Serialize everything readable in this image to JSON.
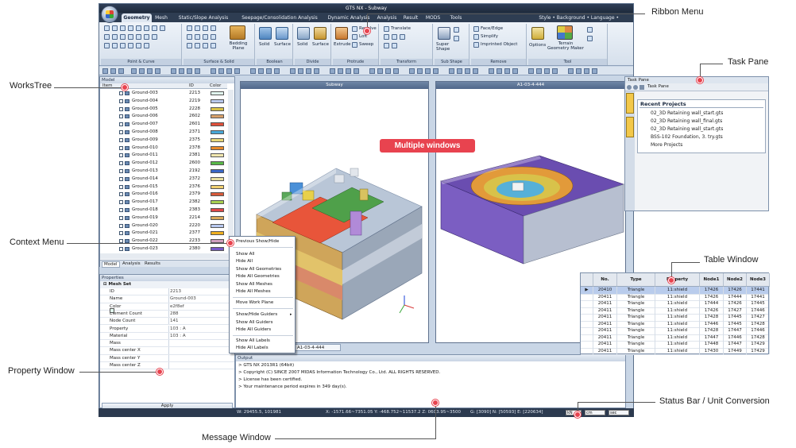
{
  "callouts": {
    "ribbon_menu": "Ribbon Menu",
    "task_pane": "Task Pane",
    "works_tree": "WorksTree",
    "context_menu": "Context Menu",
    "table_window": "Table Window",
    "property_window": "Property Window",
    "status_bar": "Status Bar / Unit Conversion",
    "message_window": "Message Window",
    "multiple_windows": "Multiple windows"
  },
  "window": {
    "title": "GTS NX - Subway"
  },
  "ribbon_tabs": [
    "Geometry",
    "Mesh",
    "Static/Slope Analysis",
    "Seepage/Consolidation Analysis",
    "Dynamic Analysis",
    "Analysis",
    "Result",
    "MODS",
    "Tools"
  ],
  "tabs_right": "Style  •  Background  •  Language  •",
  "ribbon_groups": [
    {
      "name": "Point & Curve"
    },
    {
      "name": "Surface & Solid",
      "big_label": "Bedding Plane"
    },
    {
      "name": "Boolean",
      "labels": [
        "Solid",
        "Surface"
      ]
    },
    {
      "name": "Divide",
      "labels": [
        "Solid",
        "Surface"
      ]
    },
    {
      "name": "Protrude",
      "labels": [
        "Extrude",
        "Revolve",
        "Loft",
        "Sweep"
      ]
    },
    {
      "name": "Transform",
      "labels": [
        "Translate"
      ]
    },
    {
      "name": "Sub Shape",
      "labels": [
        "Super Shape"
      ]
    },
    {
      "name": "Remove",
      "labels": [
        "Face/Edge",
        "Simplify",
        "Imprinted Object"
      ]
    },
    {
      "name": "Tool",
      "labels": [
        "Options",
        "Terrain Geometry Maker"
      ]
    }
  ],
  "works_tree": {
    "header": "Model",
    "columns": [
      "Item",
      "ID",
      "Color"
    ],
    "rows": [
      {
        "name": "Ground-003",
        "id": "2213",
        "color": "#e2f8ef"
      },
      {
        "name": "Ground-004",
        "id": "2219",
        "color": "#b9c9ee"
      },
      {
        "name": "Ground-005",
        "id": "2228",
        "color": "#d9c24a"
      },
      {
        "name": "Ground-006",
        "id": "2602",
        "color": "#d8a06a"
      },
      {
        "name": "Ground-007",
        "id": "2601",
        "color": "#e0503a"
      },
      {
        "name": "Ground-008",
        "id": "2371",
        "color": "#48a8d8"
      },
      {
        "name": "Ground-009",
        "id": "2375",
        "color": "#e8d878"
      },
      {
        "name": "Ground-010",
        "id": "2378",
        "color": "#e88a2a"
      },
      {
        "name": "Ground-011",
        "id": "2381",
        "color": "#f2e8b0"
      },
      {
        "name": "Ground-012",
        "id": "2600",
        "color": "#58b848"
      },
      {
        "name": "Ground-013",
        "id": "2192",
        "color": "#3a68c8"
      },
      {
        "name": "Ground-014",
        "id": "2372",
        "color": "#e8e0a0"
      },
      {
        "name": "Ground-015",
        "id": "2376",
        "color": "#f0d070"
      },
      {
        "name": "Ground-016",
        "id": "2379",
        "color": "#d85a3a"
      },
      {
        "name": "Ground-017",
        "id": "2382",
        "color": "#a8d050"
      },
      {
        "name": "Ground-018",
        "id": "2383",
        "color": "#e04848"
      },
      {
        "name": "Ground-019",
        "id": "2214",
        "color": "#d8a85a"
      },
      {
        "name": "Ground-020",
        "id": "2220",
        "color": "#b8c8f0"
      },
      {
        "name": "Ground-021",
        "id": "2377",
        "color": "#f0b020"
      },
      {
        "name": "Ground-022",
        "id": "2233",
        "color": "#d0a0c0"
      },
      {
        "name": "Ground-023",
        "id": "2380",
        "color": "#7858c8"
      }
    ],
    "bottom_tabs": [
      "Model",
      "Analysis",
      "Results"
    ]
  },
  "properties": {
    "header": "Properties",
    "section": "Mesh Set",
    "rows": [
      {
        "k": "ID",
        "v": "2213"
      },
      {
        "k": "Name",
        "v": "Ground-003"
      },
      {
        "k": "Color",
        "v": "e2f8ef"
      },
      {
        "k": "Element Count",
        "v": "288"
      },
      {
        "k": "Node Count",
        "v": "141"
      },
      {
        "k": "Property",
        "v": "103 : A"
      },
      {
        "k": "Material",
        "v": "103 : A"
      },
      {
        "k": "Mass",
        "v": ""
      },
      {
        "k": "Mass center X",
        "v": ""
      },
      {
        "k": "Mass center Y",
        "v": ""
      },
      {
        "k": "Mass center Z",
        "v": ""
      }
    ],
    "apply": "Apply"
  },
  "views": {
    "left_title": "Subway",
    "right_title": "A1-03-4-444",
    "tab_label": "A1-03-4-444"
  },
  "context_menu": {
    "items": [
      "Previous Show/Hide",
      "Show All",
      "Hide All",
      "Show All Geometries",
      "Hide All Geometries",
      "Show All Meshes",
      "Hide All Meshes",
      "Move Work Plane",
      "Show/Hide Guiders",
      "Show All Guiders",
      "Hide All Guiders",
      "Show All Labels",
      "Hide All Labels"
    ]
  },
  "output": {
    "header": "Output",
    "lines": [
      "> GTS NX 2013R1 (64bit)",
      "> Copyright (C) SINCE 2007 MIDAS Information Technology Co., Ltd. ALL RIGHTS RESERVED.",
      "> License has been certified.",
      "> Your maintenance period expires in 349 day(s)."
    ]
  },
  "status": {
    "w": "W: 29455.5, 101981",
    "xyz": "X: -1571.66~7351.05  Y: -468.752~11537.2  Z: 0603.95~3500",
    "g": "G: [3090]  N: [50593]  E: [220634]",
    "units": [
      "kN",
      "cm",
      "sec"
    ]
  },
  "task_pane": {
    "header": "Task Pane",
    "dropdown": "Task Pane",
    "side_tabs": [
      "Task Pane",
      "Task Pane"
    ],
    "title": "Recent Projects",
    "items": [
      "02_3D Retaining wall_start.gts",
      "02_3D Retaining wall_final.gts",
      "02_3D Retaining wall_start.gts",
      "BSS-102 Foundation, 3. try.gts",
      "More Projects"
    ]
  },
  "table": {
    "columns": [
      "No.",
      "Type",
      "Property",
      "Node1",
      "Node2",
      "Node3"
    ],
    "rows": [
      {
        "no": "20410",
        "type": "Triangle",
        "prop": "11:shield",
        "n1": "17426",
        "n2": "17426",
        "n3": "17441",
        "sel": true
      },
      {
        "no": "20411",
        "type": "Triangle",
        "prop": "11:shield",
        "n1": "17426",
        "n2": "17444",
        "n3": "17441"
      },
      {
        "no": "20411",
        "type": "Triangle",
        "prop": "11:shield",
        "n1": "17444",
        "n2": "17426",
        "n3": "17445"
      },
      {
        "no": "20411",
        "type": "Triangle",
        "prop": "11:shield",
        "n1": "17426",
        "n2": "17427",
        "n3": "17446"
      },
      {
        "no": "20411",
        "type": "Triangle",
        "prop": "11:shield",
        "n1": "17428",
        "n2": "17445",
        "n3": "17427"
      },
      {
        "no": "20411",
        "type": "Triangle",
        "prop": "11:shield",
        "n1": "17446",
        "n2": "17445",
        "n3": "17428"
      },
      {
        "no": "20411",
        "type": "Triangle",
        "prop": "11:shield",
        "n1": "17428",
        "n2": "17447",
        "n3": "17446"
      },
      {
        "no": "20411",
        "type": "Triangle",
        "prop": "11:shield",
        "n1": "17447",
        "n2": "17446",
        "n3": "17428"
      },
      {
        "no": "20411",
        "type": "Triangle",
        "prop": "11:shield",
        "n1": "17448",
        "n2": "17447",
        "n3": "17429"
      },
      {
        "no": "20411",
        "type": "Triangle",
        "prop": "11:shield",
        "n1": "17430",
        "n2": "17449",
        "n3": "17429"
      }
    ]
  },
  "colors": {
    "accent": "#e8434f",
    "titlebar": "#1e2a3b",
    "selection": "#b9ccec"
  }
}
